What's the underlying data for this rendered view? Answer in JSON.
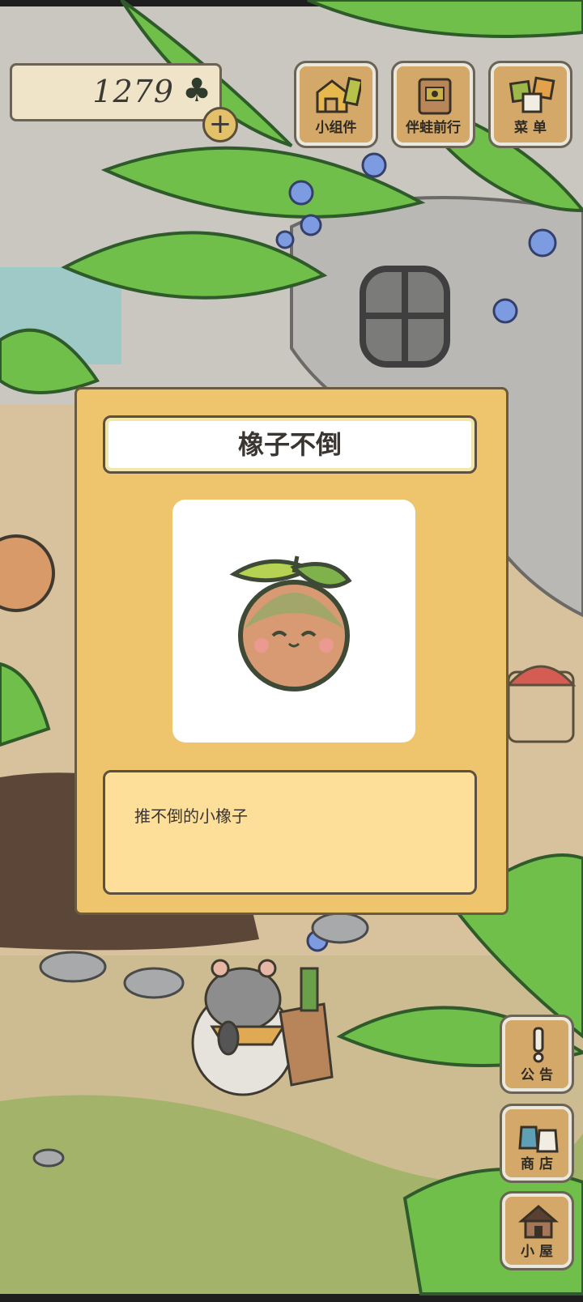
{
  "currency": {
    "amount": "1279",
    "symbol": "♣",
    "add_label": "+"
  },
  "top_menu": [
    {
      "label": "小组件",
      "icon": "widget-icon"
    },
    {
      "label": "伴蛙前行",
      "icon": "frog-album-icon"
    },
    {
      "label": "菜 单",
      "icon": "menu-cards-icon"
    }
  ],
  "side_menu": [
    {
      "label": "公 告",
      "icon": "exclamation-icon"
    },
    {
      "label": "商 店",
      "icon": "shop-bags-icon"
    },
    {
      "label": "小 屋",
      "icon": "house-icon"
    }
  ],
  "dialog": {
    "title": "橡子不倒",
    "item_icon": "acorn-tumbler-icon",
    "description": "推不倒的小橡子"
  }
}
